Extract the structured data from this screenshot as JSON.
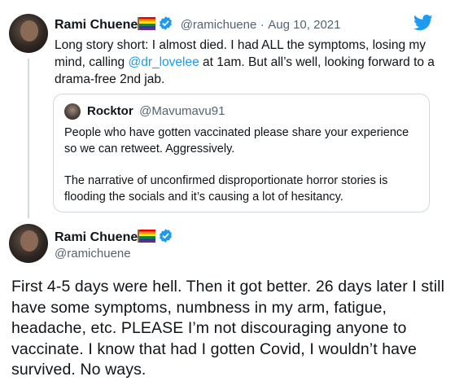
{
  "tweet1": {
    "display_name": "Rami Chuene",
    "handle": "@ramichuene",
    "separator": "·",
    "date": "Aug 10, 2021",
    "text_before": "Long story short: I almost died. I had ALL the symptoms, losing my mind, calling ",
    "mention": "@dr_lovelee",
    "text_after": " at 1am. But all’s well, looking forward to a drama-free 2nd jab."
  },
  "quote": {
    "display_name": "Rocktor",
    "handle": "@Mavumavu91",
    "para1": "People who have gotten vaccinated please share your experience so we can retweet. Aggressively.",
    "para2": "The narrative of unconfirmed disproportionate horror stories is flooding the socials and it’s causing a lot of hesitancy."
  },
  "tweet2": {
    "display_name": "Rami Chuene",
    "handle": "@ramichuene",
    "text": "First 4-5 days were hell. Then it got better. 26 days later I still have some symptoms, numbness in my arm, fatigue, headache, etc. PLEASE I’m not discouraging anyone to vaccinate. I know that had I gotten Covid, I wouldn’t have survived. No ways."
  },
  "colors": {
    "accent": "#1d9bf0",
    "muted": "#536471",
    "border": "#cfd9de",
    "text": "#0f1419"
  },
  "icons": [
    "twitter-bird-icon",
    "verified-badge-icon",
    "rainbow-flag-emoji"
  ]
}
